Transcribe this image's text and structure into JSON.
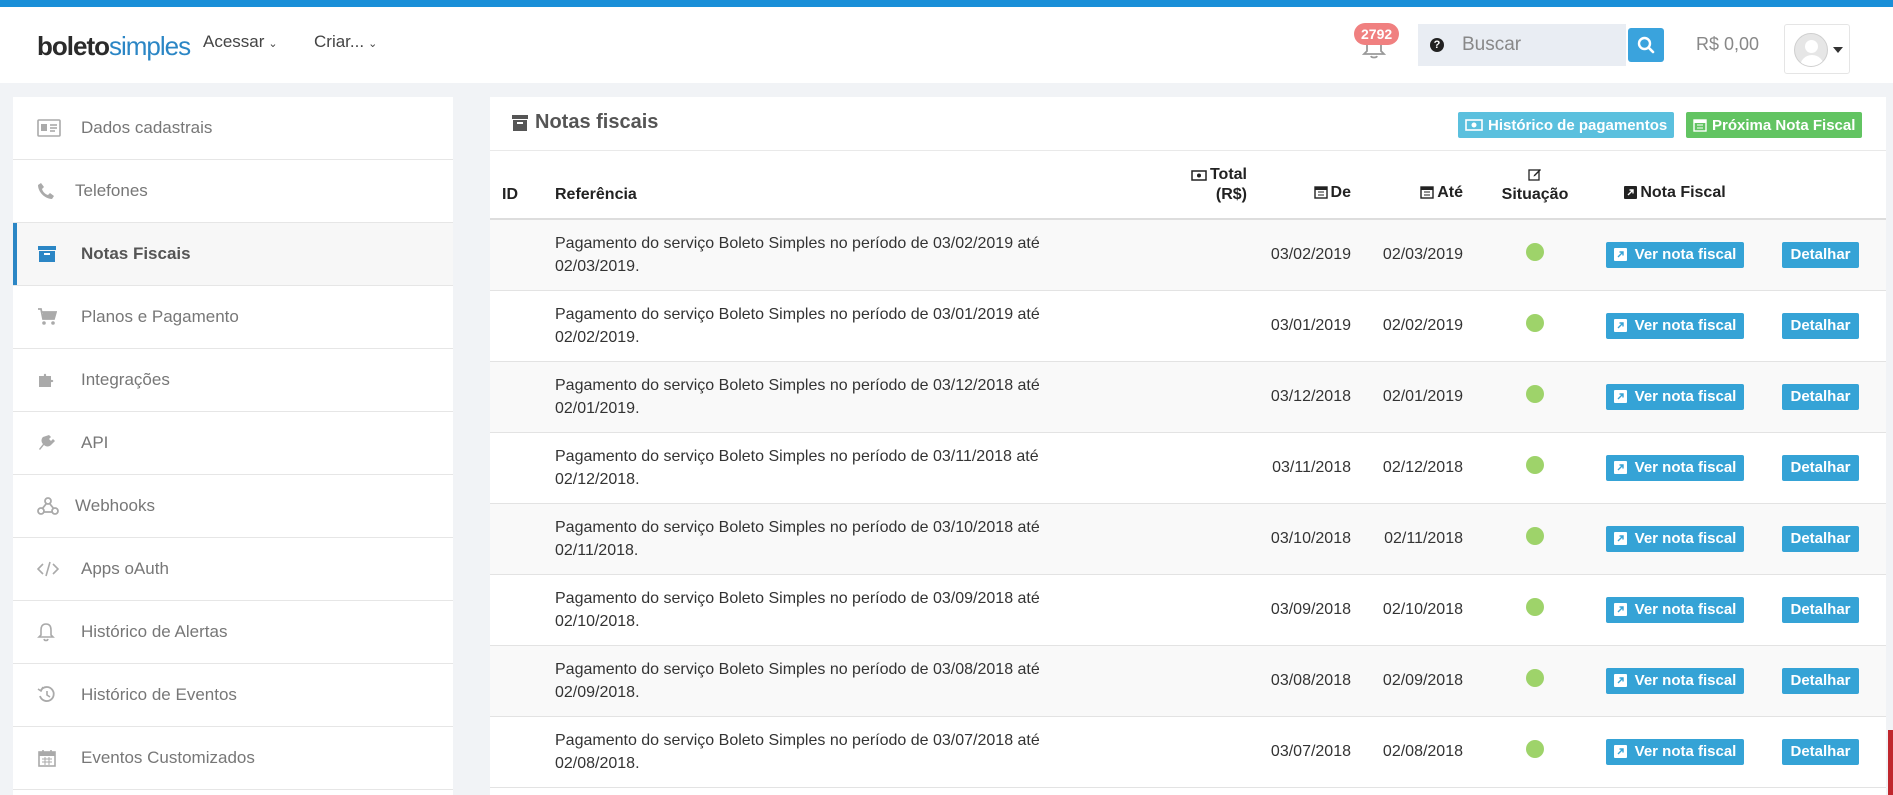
{
  "brand": {
    "part1": "boleto",
    "part2": "simples"
  },
  "nav": {
    "acessar": "Acessar",
    "criar": "Criar...",
    "notifications_count": "2792",
    "search_placeholder": "Buscar",
    "balance": "R$ 0,00"
  },
  "sidebar": {
    "items": [
      {
        "label": "Dados cadastrais",
        "icon": "id-card-icon"
      },
      {
        "label": "Telefones",
        "icon": "phone-icon"
      },
      {
        "label": "Notas Fiscais",
        "icon": "archive-icon",
        "active": true
      },
      {
        "label": "Planos e Pagamento",
        "icon": "cart-icon"
      },
      {
        "label": "Integrações",
        "icon": "puzzle-icon"
      },
      {
        "label": "API",
        "icon": "plug-icon"
      },
      {
        "label": "Webhooks",
        "icon": "webhook-icon"
      },
      {
        "label": "Apps oAuth",
        "icon": "code-icon"
      },
      {
        "label": "Histórico de Alertas",
        "icon": "bell-icon"
      },
      {
        "label": "Histórico de Eventos",
        "icon": "history-icon"
      },
      {
        "label": "Eventos Customizados",
        "icon": "calendar-icon"
      }
    ]
  },
  "panel": {
    "title": "Notas fiscais",
    "btn_history": "Histórico de pagamentos",
    "btn_next": "Próxima Nota Fiscal"
  },
  "table": {
    "headers": {
      "id": "ID",
      "referencia": "Referência",
      "total_1": "Total",
      "total_2": "(R$)",
      "de": "De",
      "ate": "Até",
      "situacao": "Situação",
      "nota_fiscal": "Nota Fiscal"
    },
    "view_label": "Ver nota fiscal",
    "detail_label": "Detalhar",
    "status_color": "#9ed36a",
    "rows": [
      {
        "ref1": "Pagamento do serviço Boleto Simples no período de 03/02/2019 até",
        "ref2": "02/03/2019.",
        "de": "03/02/2019",
        "ate": "02/03/2019"
      },
      {
        "ref1": "Pagamento do serviço Boleto Simples no período de 03/01/2019 até",
        "ref2": "02/02/2019.",
        "de": "03/01/2019",
        "ate": "02/02/2019"
      },
      {
        "ref1": "Pagamento do serviço Boleto Simples no período de 03/12/2018 até",
        "ref2": "02/01/2019.",
        "de": "03/12/2018",
        "ate": "02/01/2019"
      },
      {
        "ref1": "Pagamento do serviço Boleto Simples no período de 03/11/2018 até",
        "ref2": "02/12/2018.",
        "de": "03/11/2018",
        "ate": "02/12/2018"
      },
      {
        "ref1": "Pagamento do serviço Boleto Simples no período de 03/10/2018 até",
        "ref2": "02/11/2018.",
        "de": "03/10/2018",
        "ate": "02/11/2018"
      },
      {
        "ref1": "Pagamento do serviço Boleto Simples no período de 03/09/2018 até",
        "ref2": "02/10/2018.",
        "de": "03/09/2018",
        "ate": "02/10/2018"
      },
      {
        "ref1": "Pagamento do serviço Boleto Simples no período de 03/08/2018 até",
        "ref2": "02/09/2018.",
        "de": "03/08/2018",
        "ate": "02/09/2018"
      },
      {
        "ref1": "Pagamento do serviço Boleto Simples no período de 03/07/2018 até",
        "ref2": "02/08/2018.",
        "de": "03/07/2018",
        "ate": "02/08/2018"
      }
    ]
  },
  "colors": {
    "accent": "#1a8fd8",
    "info": "#35a3d6",
    "success": "#62c462",
    "badge": "#f08080"
  }
}
